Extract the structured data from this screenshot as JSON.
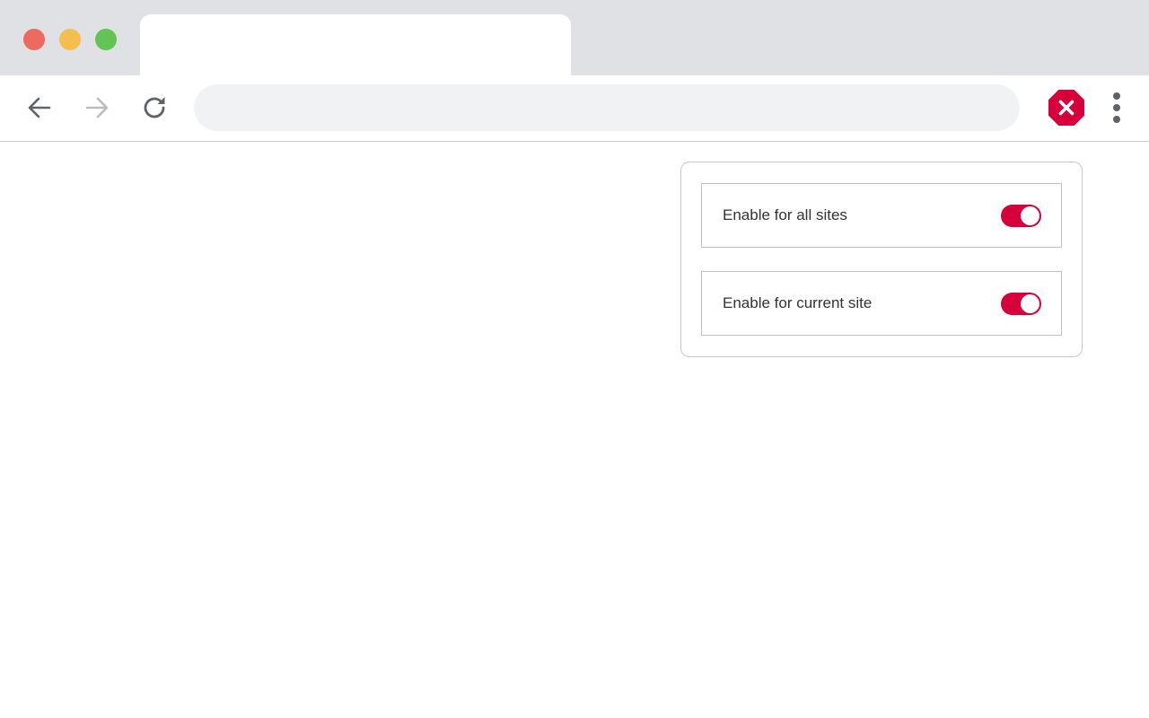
{
  "browser": {
    "tab_title": "",
    "address_placeholder": "",
    "address_value": ""
  },
  "icons": {
    "back": "arrow-left-icon",
    "forward": "arrow-right-icon",
    "reload": "reload-icon",
    "extension": "stop-sign-x-icon",
    "menu": "vertical-dots-icon"
  },
  "colors": {
    "accent": "#d6003a",
    "titlebar": "#dfe1e5",
    "omnibox": "#f1f2f4",
    "traffic_close": "#ed6a5e",
    "traffic_minimize": "#f5bf4f",
    "traffic_maximize": "#61c554"
  },
  "popup": {
    "settings": [
      {
        "label": "Enable for all sites",
        "enabled": true
      },
      {
        "label": "Enable for current site",
        "enabled": true
      }
    ]
  }
}
